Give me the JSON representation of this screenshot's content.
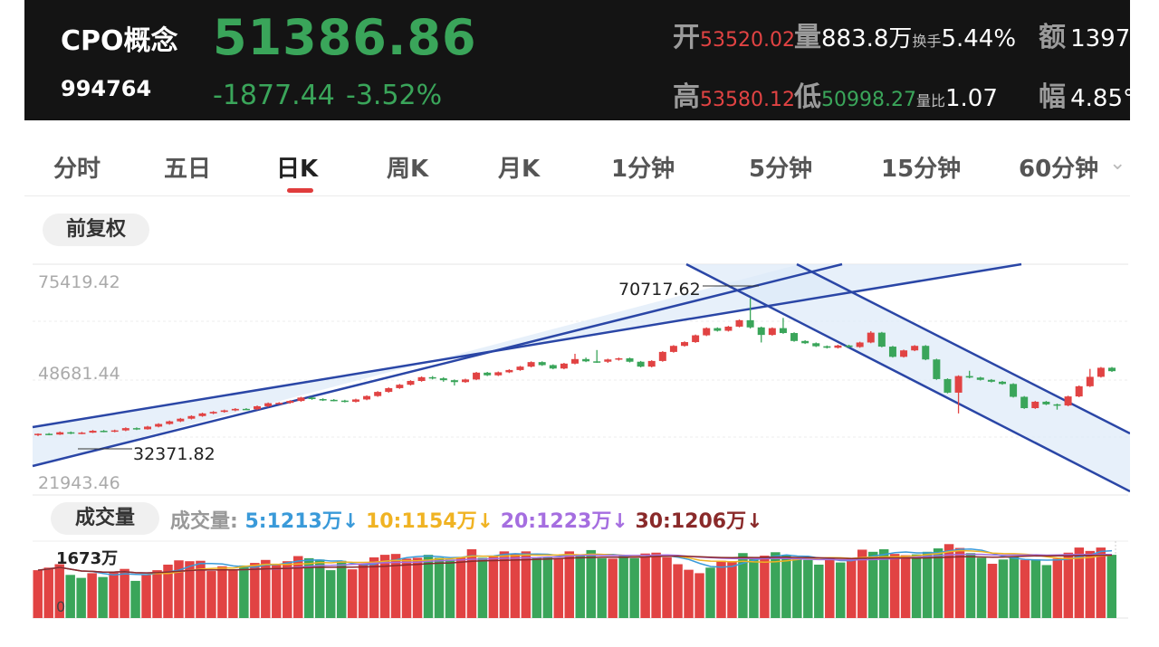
{
  "header": {
    "name": "CPO概念",
    "code": "994764",
    "price": "51386.86",
    "change": "-1877.44",
    "change_pct": "-3.52%",
    "open_label": "开",
    "open_value": "53520.02",
    "volume_label": "量",
    "volume_value": "883.8万",
    "turnover_label": "换手",
    "turnover_value": "5.44%",
    "amount_label": "额",
    "amount_value": "1397",
    "high_label": "高",
    "high_value": "53580.12",
    "low_label": "低",
    "low_value": "50998.27",
    "vol_ratio_label": "量比",
    "vol_ratio_value": "1.07",
    "amplitude_label": "幅",
    "amplitude_value": "4.85°",
    "colors": {
      "up": "#e14343",
      "down": "#3aa55a",
      "background": "#141414"
    }
  },
  "tabs": [
    "分时",
    "五日",
    "日K",
    "周K",
    "月K",
    "1分钟",
    "5分钟",
    "15分钟",
    "60分钟"
  ],
  "active_tab": "日K",
  "adjust_button": "前复权",
  "price_chart": {
    "y_labels": [
      "75419.42",
      "48681.44",
      "21943.46"
    ],
    "high_annotation": "70717.62",
    "low_annotation": "32371.82"
  },
  "volume_panel": {
    "title": "成交量",
    "legend_label": "成交量:",
    "ma5": "5:1213万↓",
    "ma10": "10:1154万↓",
    "ma20": "20:1223万↓",
    "ma30": "30:1206万↓",
    "max_label": "1673万",
    "zero_label": "0",
    "colors": {
      "ma5": "#3a9ad9",
      "ma10": "#f0b323",
      "ma20": "#a56ee0",
      "ma30": "#8a2a2a"
    }
  },
  "chart_data": {
    "type": "candlestick",
    "ylim": [
      21943.46,
      75419.42
    ],
    "highest": 70717.62,
    "lowest": 32371.82,
    "candles": [
      [
        34500,
        34800,
        34200,
        34900
      ],
      [
        34800,
        34600,
        34400,
        35000
      ],
      [
        34600,
        35200,
        34500,
        35400
      ],
      [
        35200,
        34900,
        34700,
        35400
      ],
      [
        34900,
        35100,
        34700,
        35300
      ],
      [
        35100,
        35600,
        35000,
        35800
      ],
      [
        35600,
        35400,
        35200,
        35800
      ],
      [
        35400,
        35700,
        35200,
        35900
      ],
      [
        35700,
        36300,
        35500,
        36500
      ],
      [
        36300,
        36000,
        35800,
        36500
      ],
      [
        36000,
        36700,
        35900,
        36900
      ],
      [
        36700,
        37400,
        36500,
        37600
      ],
      [
        37400,
        38100,
        37200,
        38300
      ],
      [
        38100,
        38800,
        37900,
        39000
      ],
      [
        38800,
        39500,
        38600,
        39700
      ],
      [
        39500,
        40200,
        39300,
        40400
      ],
      [
        40200,
        40600,
        40000,
        40800
      ],
      [
        40600,
        41000,
        40400,
        41200
      ],
      [
        41000,
        41400,
        40800,
        41600
      ],
      [
        41400,
        41300,
        41100,
        41600
      ],
      [
        41300,
        42100,
        41100,
        42300
      ],
      [
        42100,
        42900,
        41900,
        43100
      ],
      [
        42900,
        43000,
        42700,
        43200
      ],
      [
        43000,
        43500,
        42800,
        43700
      ],
      [
        43500,
        44400,
        43300,
        44600
      ],
      [
        44400,
        44000,
        43800,
        44600
      ],
      [
        44000,
        43800,
        43500,
        44200
      ],
      [
        43800,
        43600,
        43400,
        44000
      ],
      [
        43600,
        43300,
        43100,
        43800
      ],
      [
        43300,
        43900,
        43100,
        44100
      ],
      [
        43900,
        44800,
        43700,
        45000
      ],
      [
        44800,
        45900,
        44600,
        46100
      ],
      [
        45900,
        46900,
        45700,
        47100
      ],
      [
        46900,
        47800,
        46700,
        48000
      ],
      [
        47800,
        48800,
        47600,
        49000
      ],
      [
        48800,
        49800,
        48600,
        50000
      ],
      [
        49800,
        49500,
        49200,
        50100
      ],
      [
        49500,
        49000,
        48600,
        49800
      ],
      [
        49000,
        48500,
        47600,
        49200
      ],
      [
        48500,
        49200,
        48300,
        49400
      ],
      [
        49200,
        51000,
        49000,
        51200
      ],
      [
        51000,
        50300,
        50100,
        51200
      ],
      [
        50300,
        51100,
        50100,
        51300
      ],
      [
        51100,
        51700,
        50900,
        51900
      ],
      [
        51700,
        52600,
        51500,
        52800
      ],
      [
        52600,
        53800,
        52400,
        54000
      ],
      [
        53800,
        53000,
        52800,
        54000
      ],
      [
        53000,
        52100,
        51900,
        53200
      ],
      [
        52100,
        53400,
        51900,
        53600
      ],
      [
        53400,
        54600,
        53200,
        56000
      ],
      [
        54600,
        54000,
        53800,
        55000
      ],
      [
        54000,
        53900,
        53600,
        57000
      ],
      [
        53900,
        54500,
        53600,
        54700
      ],
      [
        54500,
        54800,
        54200,
        55000
      ],
      [
        54800,
        53900,
        53700,
        55000
      ],
      [
        53900,
        52600,
        52400,
        54100
      ],
      [
        52600,
        54100,
        52400,
        54300
      ],
      [
        54100,
        56500,
        53900,
        56700
      ],
      [
        56500,
        58100,
        56300,
        58300
      ],
      [
        58100,
        59100,
        57900,
        59300
      ],
      [
        59100,
        60900,
        58900,
        61100
      ],
      [
        60900,
        62800,
        60700,
        63000
      ],
      [
        62800,
        62100,
        61900,
        63000
      ],
      [
        62100,
        63200,
        61900,
        63400
      ],
      [
        63200,
        64900,
        63000,
        65100
      ],
      [
        64900,
        63000,
        62700,
        70700
      ],
      [
        63000,
        61000,
        59000,
        63200
      ],
      [
        61000,
        62800,
        60800,
        63000
      ],
      [
        62800,
        61500,
        61300,
        65500
      ],
      [
        61500,
        59400,
        59200,
        61700
      ],
      [
        59400,
        58800,
        58600,
        59600
      ],
      [
        58800,
        58000,
        57800,
        59000
      ],
      [
        58000,
        57600,
        57400,
        58200
      ],
      [
        57600,
        58200,
        57400,
        58400
      ],
      [
        58200,
        57800,
        57600,
        58400
      ],
      [
        57800,
        59000,
        57600,
        59200
      ],
      [
        59000,
        61600,
        58800,
        62000
      ],
      [
        61600,
        57900,
        57700,
        61800
      ],
      [
        57900,
        55200,
        55000,
        58100
      ],
      [
        55200,
        56900,
        55000,
        57100
      ],
      [
        56900,
        58100,
        56700,
        58300
      ],
      [
        58100,
        54500,
        54300,
        58300
      ],
      [
        54500,
        49300,
        49100,
        54700
      ],
      [
        49300,
        45700,
        45500,
        49500
      ],
      [
        45700,
        50100,
        40200,
        50300
      ],
      [
        50100,
        49700,
        49500,
        51500
      ],
      [
        49700,
        49100,
        48900,
        49900
      ],
      [
        49100,
        48600,
        48400,
        49300
      ],
      [
        48600,
        48000,
        47800,
        48800
      ],
      [
        48000,
        44600,
        44400,
        48200
      ],
      [
        44600,
        41600,
        41400,
        44800
      ],
      [
        41600,
        43300,
        41400,
        43500
      ],
      [
        43300,
        42600,
        42400,
        43500
      ],
      [
        42600,
        42300,
        41200,
        42800
      ],
      [
        42300,
        44700,
        42100,
        44900
      ],
      [
        44700,
        47400,
        44500,
        47600
      ],
      [
        47400,
        49900,
        47200,
        52000
      ],
      [
        49900,
        52300,
        49700,
        52500
      ],
      [
        52300,
        51400,
        51200,
        52500
      ]
    ],
    "volume": [
      {
        "v": 1120,
        "up": 1
      },
      {
        "v": 1180,
        "up": 1
      },
      {
        "v": 1260,
        "up": 1
      },
      {
        "v": 1010,
        "up": 0
      },
      {
        "v": 940,
        "up": 0
      },
      {
        "v": 1050,
        "up": 1
      },
      {
        "v": 960,
        "up": 0
      },
      {
        "v": 1080,
        "up": 1
      },
      {
        "v": 1150,
        "up": 1
      },
      {
        "v": 870,
        "up": 0
      },
      {
        "v": 1010,
        "up": 1
      },
      {
        "v": 1120,
        "up": 1
      },
      {
        "v": 1250,
        "up": 1
      },
      {
        "v": 1350,
        "up": 1
      },
      {
        "v": 1330,
        "up": 1
      },
      {
        "v": 1340,
        "up": 1
      },
      {
        "v": 1100,
        "up": 1
      },
      {
        "v": 1210,
        "up": 1
      },
      {
        "v": 1120,
        "up": 1
      },
      {
        "v": 1230,
        "up": 0
      },
      {
        "v": 1290,
        "up": 1
      },
      {
        "v": 1360,
        "up": 1
      },
      {
        "v": 1240,
        "up": 1
      },
      {
        "v": 1330,
        "up": 1
      },
      {
        "v": 1450,
        "up": 1
      },
      {
        "v": 1400,
        "up": 0
      },
      {
        "v": 1370,
        "up": 0
      },
      {
        "v": 1120,
        "up": 0
      },
      {
        "v": 1340,
        "up": 0
      },
      {
        "v": 1140,
        "up": 1
      },
      {
        "v": 1270,
        "up": 1
      },
      {
        "v": 1420,
        "up": 1
      },
      {
        "v": 1480,
        "up": 1
      },
      {
        "v": 1500,
        "up": 1
      },
      {
        "v": 1390,
        "up": 1
      },
      {
        "v": 1410,
        "up": 1
      },
      {
        "v": 1480,
        "up": 0
      },
      {
        "v": 1410,
        "up": 0
      },
      {
        "v": 1370,
        "up": 0
      },
      {
        "v": 1420,
        "up": 1
      },
      {
        "v": 1610,
        "up": 1
      },
      {
        "v": 1410,
        "up": 0
      },
      {
        "v": 1450,
        "up": 1
      },
      {
        "v": 1560,
        "up": 1
      },
      {
        "v": 1500,
        "up": 1
      },
      {
        "v": 1560,
        "up": 1
      },
      {
        "v": 1420,
        "up": 0
      },
      {
        "v": 1430,
        "up": 0
      },
      {
        "v": 1400,
        "up": 1
      },
      {
        "v": 1560,
        "up": 1
      },
      {
        "v": 1490,
        "up": 0
      },
      {
        "v": 1590,
        "up": 0
      },
      {
        "v": 1400,
        "up": 0
      },
      {
        "v": 1390,
        "up": 1
      },
      {
        "v": 1450,
        "up": 0
      },
      {
        "v": 1400,
        "up": 0
      },
      {
        "v": 1510,
        "up": 1
      },
      {
        "v": 1530,
        "up": 1
      },
      {
        "v": 1420,
        "up": 1
      },
      {
        "v": 1260,
        "up": 1
      },
      {
        "v": 1130,
        "up": 1
      },
      {
        "v": 1050,
        "up": 1
      },
      {
        "v": 1180,
        "up": 0
      },
      {
        "v": 1340,
        "up": 1
      },
      {
        "v": 1330,
        "up": 1
      },
      {
        "v": 1520,
        "up": 0
      },
      {
        "v": 1390,
        "up": 0
      },
      {
        "v": 1460,
        "up": 1
      },
      {
        "v": 1540,
        "up": 0
      },
      {
        "v": 1470,
        "up": 0
      },
      {
        "v": 1390,
        "up": 0
      },
      {
        "v": 1360,
        "up": 0
      },
      {
        "v": 1250,
        "up": 0
      },
      {
        "v": 1420,
        "up": 1
      },
      {
        "v": 1300,
        "up": 0
      },
      {
        "v": 1380,
        "up": 1
      },
      {
        "v": 1600,
        "up": 1
      },
      {
        "v": 1550,
        "up": 0
      },
      {
        "v": 1610,
        "up": 0
      },
      {
        "v": 1500,
        "up": 1
      },
      {
        "v": 1470,
        "up": 1
      },
      {
        "v": 1490,
        "up": 0
      },
      {
        "v": 1550,
        "up": 0
      },
      {
        "v": 1630,
        "up": 0
      },
      {
        "v": 1730,
        "up": 1
      },
      {
        "v": 1640,
        "up": 1
      },
      {
        "v": 1520,
        "up": 0
      },
      {
        "v": 1410,
        "up": 0
      },
      {
        "v": 1270,
        "up": 1
      },
      {
        "v": 1370,
        "up": 0
      },
      {
        "v": 1440,
        "up": 0
      },
      {
        "v": 1360,
        "up": 1
      },
      {
        "v": 1370,
        "up": 0
      },
      {
        "v": 1240,
        "up": 0
      },
      {
        "v": 1390,
        "up": 1
      },
      {
        "v": 1530,
        "up": 1
      },
      {
        "v": 1650,
        "up": 1
      },
      {
        "v": 1570,
        "up": 1
      },
      {
        "v": 1650,
        "up": 1
      },
      {
        "v": 1480,
        "up": 0
      }
    ]
  }
}
